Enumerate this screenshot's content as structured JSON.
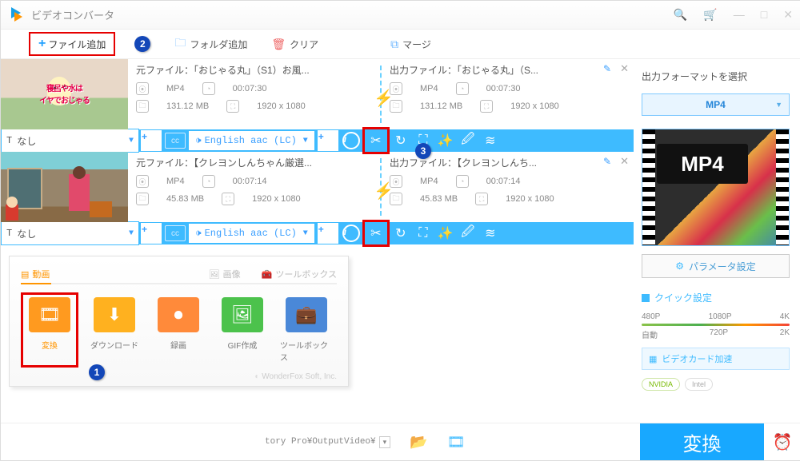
{
  "title": "ビデオコンバータ",
  "topbar": {
    "add_file": "ファイル追加",
    "add_folder": "フォルダ追加",
    "clear": "クリア",
    "merge": "マージ"
  },
  "files": [
    {
      "thumb_sub": "寝呂や水は\nイヤでおじゃる",
      "src": {
        "title": "元ファイル：「おじゃる丸」（S1）お風...",
        "fmt": "MP4",
        "dur": "00:07:30",
        "size": "131.12 MB",
        "res": "1920 x 1080"
      },
      "out": {
        "title": "出力ファイル：「おじゃる丸」（S...",
        "fmt": "MP4",
        "dur": "00:07:30",
        "size": "131.12 MB",
        "res": "1920 x 1080"
      },
      "subtitle": "なし",
      "audio": "English aac (LC)"
    },
    {
      "src": {
        "title": "元ファイル：【クレヨンしんちゃん厳選...",
        "fmt": "MP4",
        "dur": "00:07:14",
        "size": "45.83 MB",
        "res": "1920 x 1080"
      },
      "out": {
        "title": "出力ファイル：【クレヨンしんち...",
        "fmt": "MP4",
        "dur": "00:07:14",
        "size": "45.83 MB",
        "res": "1920 x 1080"
      },
      "subtitle": "なし",
      "audio": "English aac (LC)"
    }
  ],
  "tools": {
    "tab_video": "動画",
    "tab_image": "画像",
    "tab_toolbox": "ツールボックス",
    "convert": "変換",
    "download": "ダウンロード",
    "record": "録画",
    "gif": "GIF作成",
    "toolbox": "ツールボックス"
  },
  "wonderfox": "WonderFox Soft, Inc.",
  "footer": {
    "out_path": "tory Pro¥OutputVideo¥",
    "convert": "変換"
  },
  "right": {
    "format_label": "出力フォーマットを選択",
    "format": "MP4",
    "param": "パラメータ設定",
    "quick": "クイック設定",
    "presets": [
      "480P",
      "1080P",
      "4K"
    ],
    "presets2": [
      "自動",
      "720P",
      "2K"
    ],
    "gpu": "ビデオカード加速",
    "nvidia": "NVIDIA",
    "intel": "Intel"
  }
}
